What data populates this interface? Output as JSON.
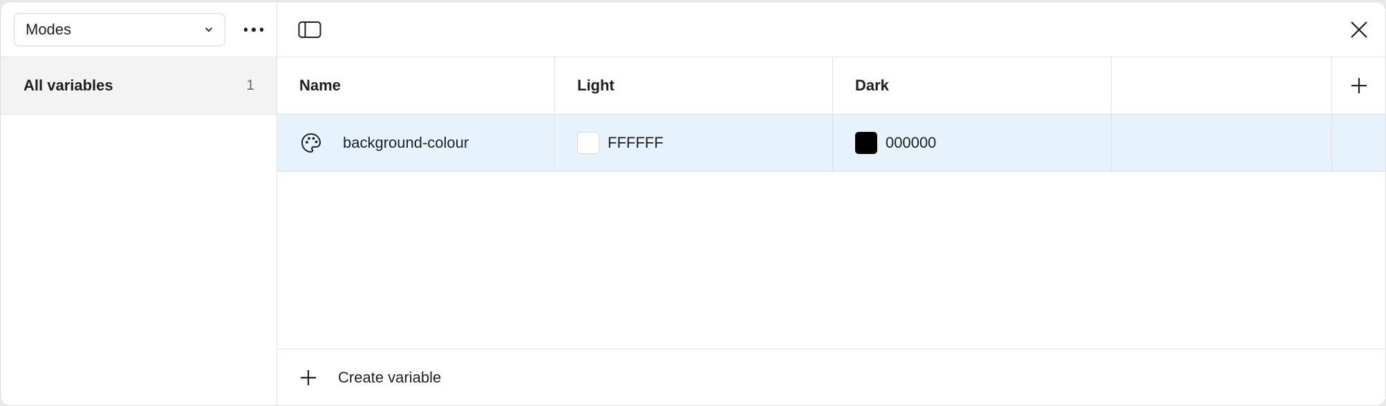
{
  "sidebar": {
    "collection_select": {
      "value": "Modes"
    },
    "groups": [
      {
        "label": "All variables",
        "count": "1"
      }
    ]
  },
  "table": {
    "columns": {
      "name": "Name",
      "light": "Light",
      "dark": "Dark"
    },
    "rows": [
      {
        "name": "background-colour",
        "light_value": "FFFFFF",
        "dark_value": "000000",
        "light_color": "#FFFFFF",
        "dark_color": "#000000",
        "icon": "palette-icon"
      }
    ]
  },
  "footer": {
    "create_label": "Create variable"
  },
  "colors": {
    "selected_row": "#e7f3fc",
    "sidebar_selected": "#f3f3f3"
  }
}
